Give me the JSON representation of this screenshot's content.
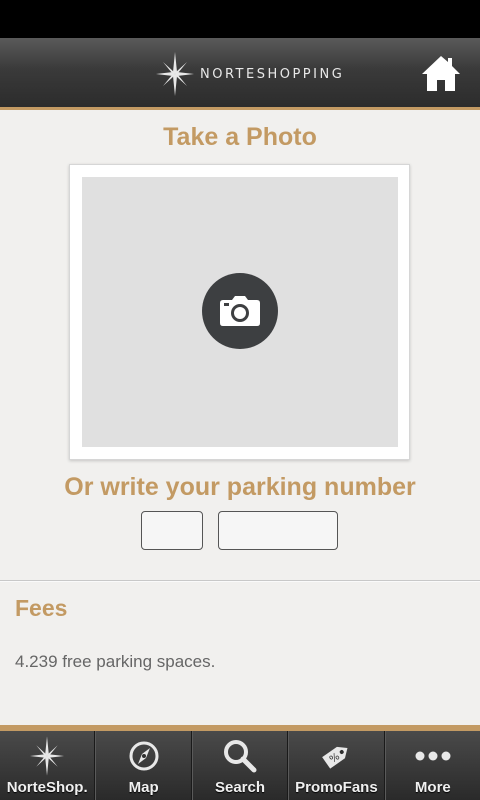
{
  "header": {
    "logo_text": "NORTESHOPPING"
  },
  "photo": {
    "title": "Take a Photo"
  },
  "parking": {
    "title": "Or write your parking number",
    "field_a_value": "",
    "field_b_value": ""
  },
  "fees": {
    "title": "Fees",
    "text": "4.239 free parking spaces."
  },
  "tabs": [
    {
      "label": "NorteShop.",
      "icon": "compass-star-icon"
    },
    {
      "label": "Map",
      "icon": "compass-icon"
    },
    {
      "label": "Search",
      "icon": "search-icon"
    },
    {
      "label": "PromoFans",
      "icon": "tag-icon"
    },
    {
      "label": "More",
      "icon": "more-icon"
    }
  ],
  "colors": {
    "accent": "#c39a63",
    "header_bg": "#3a3a3a",
    "tabbar_bg": "#2a2a2a",
    "camera_bg": "#3d3f41"
  }
}
